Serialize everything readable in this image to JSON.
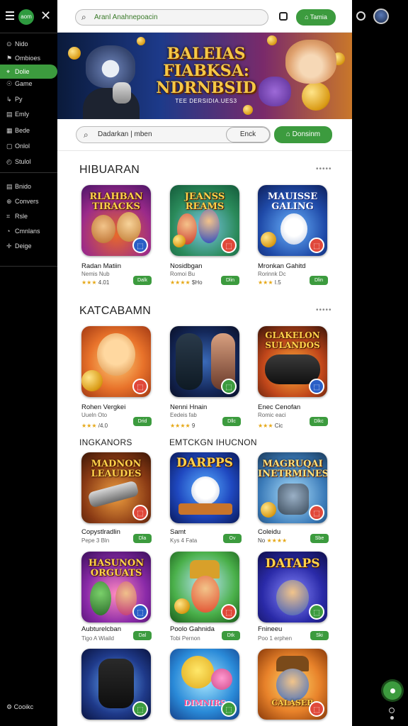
{
  "sidebar": {
    "brand": "aom",
    "items": [
      {
        "icon": "compass-icon",
        "glyph": "⊙",
        "label": "Nido"
      },
      {
        "icon": "trophy-icon",
        "glyph": "⚑",
        "label": "Ombioes"
      },
      {
        "icon": "gamepad-icon",
        "glyph": "⌖",
        "label": "Dolie"
      },
      {
        "icon": "controller-icon",
        "glyph": "☉",
        "label": "Game"
      },
      {
        "icon": "play-icon",
        "glyph": "↳",
        "label": "Py"
      },
      {
        "icon": "document-icon",
        "glyph": "▤",
        "label": "Emly"
      },
      {
        "icon": "grid-icon",
        "glyph": "▦",
        "label": "Bede"
      },
      {
        "icon": "chat-icon",
        "glyph": "▢",
        "label": "Onlol"
      },
      {
        "icon": "clock-icon",
        "glyph": "◴",
        "label": "Stulol"
      },
      {
        "icon": "calendar-icon",
        "glyph": "▤",
        "label": "Bnido"
      },
      {
        "icon": "globe-icon",
        "glyph": "⊕",
        "label": "Convers"
      },
      {
        "icon": "tag-icon",
        "glyph": "⌗",
        "label": "Rsle"
      },
      {
        "icon": "clock2-icon",
        "glyph": "◔",
        "label": "Cmnlans"
      },
      {
        "icon": "plus-icon",
        "glyph": "✛",
        "label": "Deige"
      }
    ],
    "cookie_label": "Cooikc"
  },
  "topbar": {
    "search_placeholder": "Aranl  Anahnepoacin",
    "cta_label": "Tamia"
  },
  "hero": {
    "title": "BALEIAS FIABKSA: NDRNBSID",
    "subtitle": "TEE DERSIDIA.UES3"
  },
  "searchbar": {
    "placeholder": "Dadarkan | mben",
    "enc_label": "Enck",
    "donate_label": "Donsinm"
  },
  "sections": {
    "s1": {
      "title": "HIBUARAN",
      "more": "•••••"
    },
    "s2": {
      "title": "KATCABAMN",
      "more": "•••••"
    },
    "s3a": {
      "title": "INGKANORS"
    },
    "s3b": {
      "title": "EMTCKGN IHUCNON"
    }
  },
  "colors": {
    "accent": "#3c9b3e",
    "badge_red": "#e0483a",
    "badge_green": "#3c9b3e",
    "badge_blue": "#2a5fc6",
    "star": "#e6a817"
  },
  "cards": [
    {
      "art": "RLAHBAN TIRACKS",
      "name": "Radan Matiin",
      "sub": "Nemis Nub",
      "stars": "★★★",
      "rating": "4.01",
      "btn": "Dalk"
    },
    {
      "art": "JEANSS REAMS",
      "name": "Nosidbgan",
      "sub": "Romoi Bu",
      "stars": "★★★★",
      "rating": "$Ho",
      "btn": "Dlin"
    },
    {
      "art": "MAUISSE GALING",
      "name": "Mronkan Gahitd",
      "sub": "Rorinnk Dc",
      "stars": "★★★",
      "rating": "I.5",
      "btn": "Dlin"
    },
    {
      "art": "",
      "name": "Rohen Vergkei",
      "sub": "Uueln Oto",
      "stars": "★★★",
      "rating": "/4.0",
      "btn": "Drid"
    },
    {
      "art": "",
      "name": "Nenni Hnain",
      "sub": "Eedeis fab",
      "stars": "★★★★",
      "rating": "9",
      "btn": "Dllc"
    },
    {
      "art": "GLAKELON SULANDOS",
      "name": "Enec Cenofan",
      "sub": "Romic eaci",
      "stars": "★★★",
      "rating": "Cic",
      "btn": "Dlkc"
    },
    {
      "art": "MADNON LEAUDES",
      "name": "Copystlradlin",
      "sub": "Pepe 3 Bln",
      "stars": "",
      "rating": "",
      "btn": "Dla"
    },
    {
      "art": "DARPPS",
      "name": "Samt",
      "sub": "Kys 4 Fata",
      "stars": "",
      "rating": "",
      "btn": "Ov"
    },
    {
      "art": "MAGRUQAI INETRMINES",
      "name": "Coleidu",
      "sub": "No",
      "stars": "★★★★",
      "rating": "",
      "btn": "Sbe"
    },
    {
      "art": "HASUNON ORGUATS",
      "name": "Aubturelcban",
      "sub": "Tigo A Wiaild",
      "stars": "",
      "rating": "",
      "btn": "Dal"
    },
    {
      "art": "",
      "name": "Poolo Gahnida",
      "sub": "Tobi Pernon",
      "stars": "",
      "rating": "",
      "btn": "Dtk"
    },
    {
      "art": "DATAPS",
      "name": "Fnineeu",
      "sub": "Poo 1 erphen",
      "stars": "",
      "rating": "",
      "btn": "Ski"
    },
    {
      "art": "",
      "name": "",
      "sub": "",
      "stars": "",
      "rating": "",
      "btn": ""
    },
    {
      "art": "DIMNIRS",
      "name": "",
      "sub": "",
      "stars": "",
      "rating": "",
      "btn": ""
    },
    {
      "art": "CALASEB",
      "name": "",
      "sub": "",
      "stars": "",
      "rating": "",
      "btn": ""
    }
  ]
}
